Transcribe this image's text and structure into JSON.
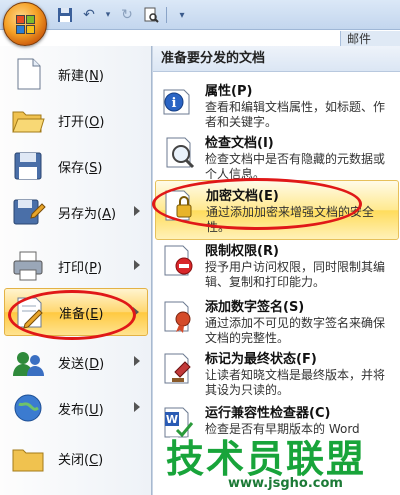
{
  "quick_access": {
    "tab_label": "邮件"
  },
  "commands": [
    {
      "label": "新建",
      "key": "N",
      "icon": "new-document-icon",
      "has_submenu": false
    },
    {
      "label": "打开",
      "key": "O",
      "icon": "open-folder-icon",
      "has_submenu": false
    },
    {
      "label": "保存",
      "key": "S",
      "icon": "save-icon",
      "has_submenu": false
    },
    {
      "label": "另存为",
      "key": "A",
      "icon": "save-as-icon",
      "has_submenu": true
    },
    {
      "label": "打印",
      "key": "P",
      "icon": "printer-icon",
      "has_submenu": true
    },
    {
      "label": "准备",
      "key": "E",
      "icon": "prepare-icon",
      "has_submenu": true,
      "active": true
    },
    {
      "label": "发送",
      "key": "D",
      "icon": "send-icon",
      "has_submenu": true
    },
    {
      "label": "发布",
      "key": "U",
      "icon": "publish-icon",
      "has_submenu": true
    },
    {
      "label": "关闭",
      "key": "C",
      "icon": "close-folder-icon",
      "has_submenu": false
    }
  ],
  "submenu": {
    "header": "准备要分发的文档",
    "items": [
      {
        "title": "属性(P)",
        "desc": "查看和编辑文档属性，如标题、作者和关键字。",
        "icon": "properties-icon"
      },
      {
        "title": "检查文档(I)",
        "desc": "检查文档中是否有隐藏的元数据或个人信息。",
        "icon": "inspect-document-icon"
      },
      {
        "title": "加密文档(E)",
        "desc": "通过添加加密来增强文档的安全性。",
        "icon": "encrypt-document-icon",
        "active": true
      },
      {
        "title": "限制权限(R)",
        "desc": "授予用户访问权限，同时限制其编辑、复制和打印能力。",
        "icon": "restrict-permission-icon"
      },
      {
        "title": "添加数字签名(S)",
        "desc": "通过添加不可见的数字签名来确保文档的完整性。",
        "icon": "digital-signature-icon"
      },
      {
        "title": "标记为最终状态(F)",
        "desc": "让读者知晓文档是最终版本，并将其设为只读的。",
        "icon": "mark-final-icon"
      },
      {
        "title": "运行兼容性检查器(C)",
        "desc": "检查是否有早期版本的 Word",
        "icon": "compatibility-checker-icon"
      }
    ]
  },
  "watermark": {
    "brand": "技术员联盟",
    "url": "www.jsgho.com"
  },
  "colors": {
    "highlight": "#ffd770",
    "annotation_red": "#e01818",
    "watermark_green": "#18a43a"
  }
}
